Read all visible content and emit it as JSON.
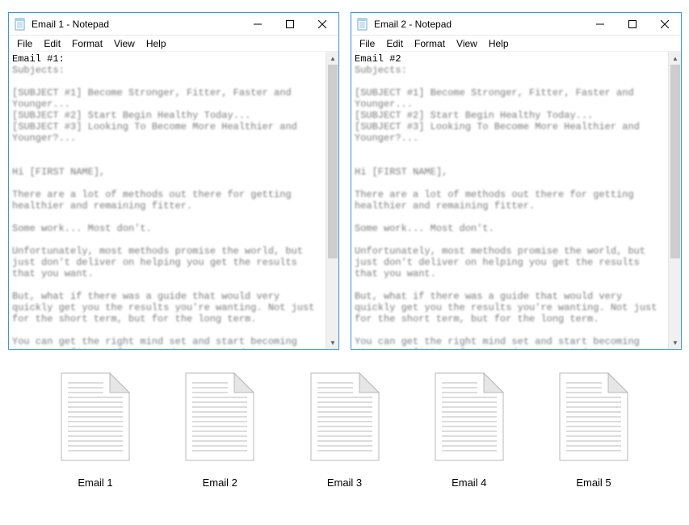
{
  "windows": [
    {
      "title": "Email 1 - Notepad",
      "header": "Email #1:",
      "body": "\nSubjects:\n\n[SUBJECT #1] Become Stronger, Fitter, Faster and Younger...\n[SUBJECT #2] Start Begin Healthy Today...\n[SUBJECT #3] Looking To Become More Healthier and Younger?...\n\n\nHi [FIRST NAME],\n\nThere are a lot of methods out there for getting healthier and remaining fitter.\n\nSome work... Most don't.\n\nUnfortunately, most methods promise the world, but just don't deliver on helping you get the results that you want.\n\nBut, what if there was a guide that would very quickly get you the results you're wanting. Not just for the short term, but for the long term.\n\nYou can get the right mind set and start becoming stronger, fitter, faster and younger today.\n\nThe best part? You're actually helping your loved ones as you'll be fitter and healthier to spend quality time with them.\n\nTo discover what how this can be achieved today by clicking the"
    },
    {
      "title": "Email 2 - Notepad",
      "header": "Email #2",
      "body": "\nSubjects:\n\n[SUBJECT #1] Become Stronger, Fitter, Faster and Younger...\n[SUBJECT #2] Start Begin Healthy Today...\n[SUBJECT #3] Looking To Become More Healthier and Younger?...\n\n\nHi [FIRST NAME],\n\nThere are a lot of methods out there for getting healthier and remaining fitter.\n\nSome work... Most don't.\n\nUnfortunately, most methods promise the world, but just don't deliver on helping you get the results that you want.\n\nBut, what if there was a guide that would very quickly get you the results you're wanting. Not just for the short term, but for the long term.\n\nYou can get the right mind set and start becoming stronger, fitter, faster and younger today.\n\nThe best part? You're actually helping your loved ones as you'll be fitter and healthier to spend quality time with them.\n\nTo discover what how this can be achieved today by clicking the"
    }
  ],
  "menu": {
    "file": "File",
    "edit": "Edit",
    "format": "Format",
    "view": "View",
    "help": "Help"
  },
  "files": [
    {
      "label": "Email 1"
    },
    {
      "label": "Email 2"
    },
    {
      "label": "Email 3"
    },
    {
      "label": "Email 4"
    },
    {
      "label": "Email 5"
    }
  ]
}
